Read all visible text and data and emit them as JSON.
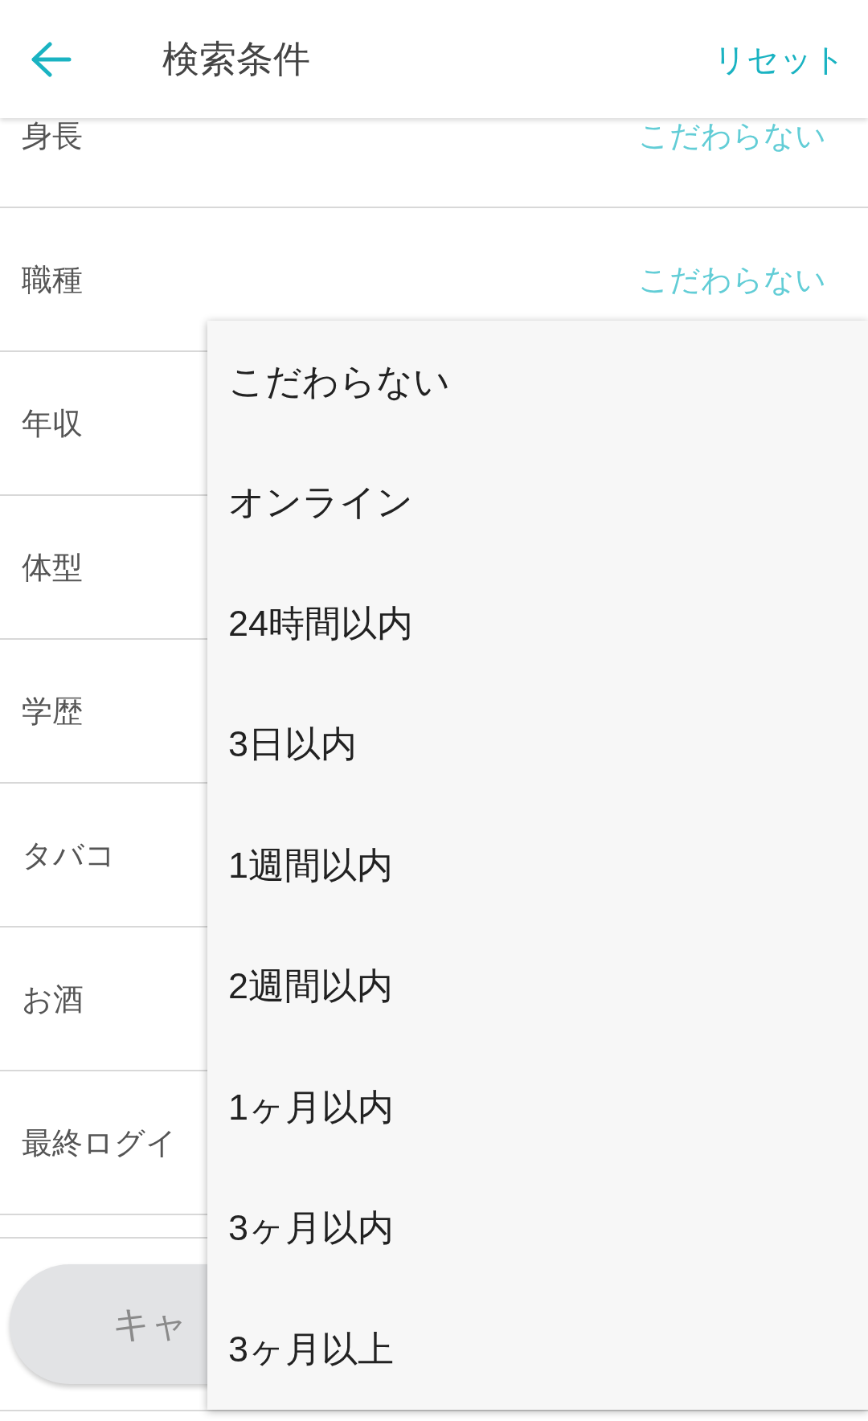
{
  "header": {
    "title": "検索条件",
    "reset": "リセット"
  },
  "rows": [
    {
      "label": "身長",
      "value": "こだわらない"
    },
    {
      "label": "職種",
      "value": "こだわらない"
    },
    {
      "label": "年収"
    },
    {
      "label": "体型"
    },
    {
      "label": "学歴"
    },
    {
      "label": "タバコ"
    },
    {
      "label": "お酒"
    },
    {
      "label": "最終ログイ"
    }
  ],
  "cancel_button": "キャ",
  "menu": [
    "こだわらない",
    "オンライン",
    "24時間以内",
    "3日以内",
    "1週間以内",
    "2週間以内",
    "1ヶ月以内",
    "3ヶ月以内",
    "3ヶ月以上"
  ]
}
